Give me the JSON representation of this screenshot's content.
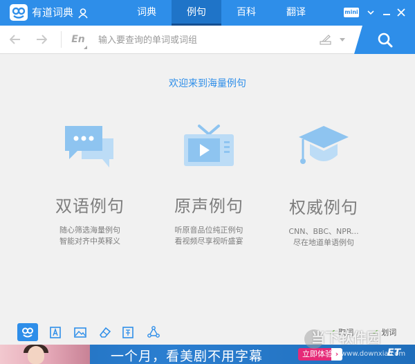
{
  "app": {
    "title": "有道词典",
    "logo": "有道词典"
  },
  "nav": {
    "tabs": [
      {
        "label": "词典",
        "active": false
      },
      {
        "label": "例句",
        "active": true
      },
      {
        "label": "百科",
        "active": false
      },
      {
        "label": "翻译",
        "active": false
      }
    ]
  },
  "window": {
    "mini_label": "mini"
  },
  "search": {
    "lang": "En",
    "placeholder": "输入要查询的单词或词组"
  },
  "main": {
    "welcome": "欢迎来到海量例句",
    "features": [
      {
        "title": "双语例句",
        "line1": "随心筛选海量例句",
        "line2": "智能对齐中英释义",
        "icon": "chat-bubbles-icon"
      },
      {
        "title": "原声例句",
        "line1": "听原音品位纯正例句",
        "line2": "看视频尽享视听盛宴",
        "icon": "tv-icon"
      },
      {
        "title": "权威例句",
        "line1": "CNN、BBC、NPR...",
        "line2": "尽在地道单语例句",
        "icon": "graduation-cap-icon"
      }
    ]
  },
  "toolbar": {
    "checks": [
      {
        "label": "取词",
        "checked": true
      },
      {
        "label": "划词",
        "checked": true
      }
    ]
  },
  "ad": {
    "text": "一个月，看美剧不用字幕",
    "button": "立即体验",
    "logo": "ET"
  },
  "watermark": {
    "text": "当下软件园",
    "sub": "www.downxia.com"
  },
  "colors": {
    "accent": "#2e8ee9",
    "icon_light": "#a9d1f4",
    "text_gray": "#7d7d7d",
    "ad_button": "#e52a78"
  }
}
